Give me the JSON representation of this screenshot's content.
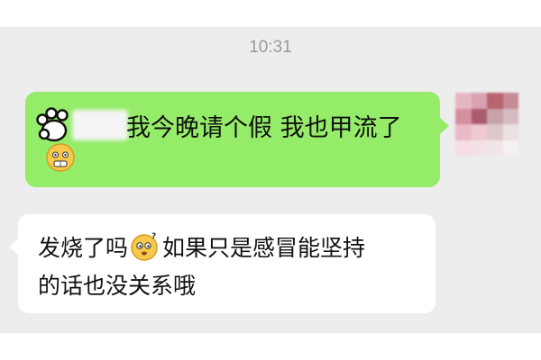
{
  "chat": {
    "timestamp": "10:31",
    "messages": [
      {
        "sender": "me",
        "text": "我今晚请个假 我也甲流了",
        "icons": [
          "paw-icon",
          "scared-face-emoji"
        ]
      },
      {
        "sender": "other",
        "lines": [
          {
            "before": "发烧了吗",
            "after": "如果只是感冒能坚持"
          },
          {
            "text": "的话也没关系哦"
          }
        ],
        "icons": [
          "thinking-face-emoji"
        ]
      }
    ]
  },
  "colors": {
    "chat_background": "#ededed",
    "outgoing_bubble": "#95ec69",
    "incoming_bubble": "#ffffff",
    "timestamp_text": "#9a9a9a"
  }
}
